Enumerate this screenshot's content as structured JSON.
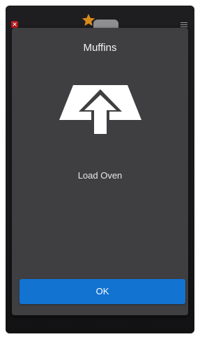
{
  "dialog": {
    "title": "Muffins",
    "icon": "upload-arrow-icon",
    "message": "Load Oven",
    "ok_label": "OK"
  },
  "status_bar": {
    "left_icon": "close-icon",
    "center_icon": "star-icon",
    "right_icon": "menu-icon"
  },
  "colors": {
    "button_accent": "#1273d1",
    "dialog_background": "#3f3f41",
    "star": "#d98a1c",
    "close": "#b3191c"
  }
}
